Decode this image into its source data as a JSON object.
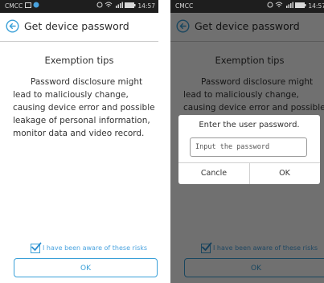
{
  "status_bar": {
    "carrier": "CMCC",
    "time": "14:57"
  },
  "page": {
    "title": "Get device password",
    "heading": "Exemption tips",
    "body": "Password disclosure might lead to maliciously change, causing device error and possible leakage of personal information, monitor data and video record.",
    "agree_label": "I have been aware of these risks",
    "agree_checked": true,
    "ok_label": "OK"
  },
  "dialog": {
    "title": "Enter the user password.",
    "input_placeholder": "Input the password",
    "cancel_label": "Cancle",
    "ok_label": "OK"
  },
  "colors": {
    "accent": "#3aa0d8",
    "status_bar": "#1e1e1e",
    "overlay": "rgba(0,0,0,0.56)"
  },
  "icons": {
    "back": "back-arrow-circle-icon",
    "check": "checkmark-icon"
  }
}
